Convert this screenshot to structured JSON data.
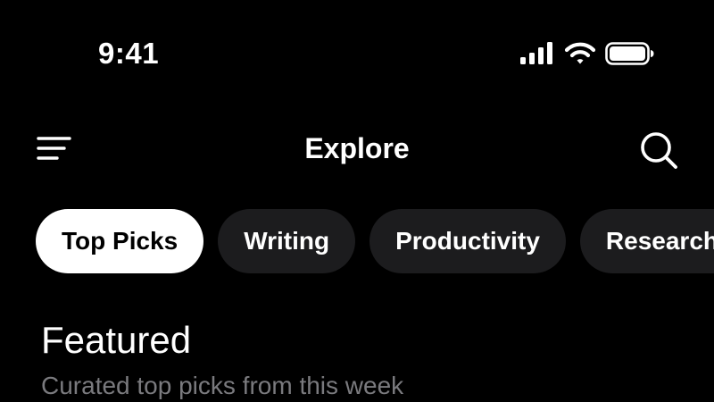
{
  "status_bar": {
    "time": "9:41",
    "icons": [
      "cellular-signal-icon",
      "wifi-icon",
      "battery-icon"
    ]
  },
  "header": {
    "title": "Explore",
    "menu_icon": "menu-icon",
    "search_icon": "search-icon"
  },
  "categories": {
    "items": [
      {
        "label": "Top Picks",
        "active": true
      },
      {
        "label": "Writing",
        "active": false
      },
      {
        "label": "Productivity",
        "active": false
      },
      {
        "label": "Research",
        "active": false
      }
    ]
  },
  "featured": {
    "title": "Featured",
    "subtitle": "Curated top picks from this week"
  },
  "colors": {
    "background": "#000000",
    "chip_background": "#1c1c1e",
    "chip_active_background": "#ffffff",
    "subtitle_text": "#7a7a7e"
  }
}
